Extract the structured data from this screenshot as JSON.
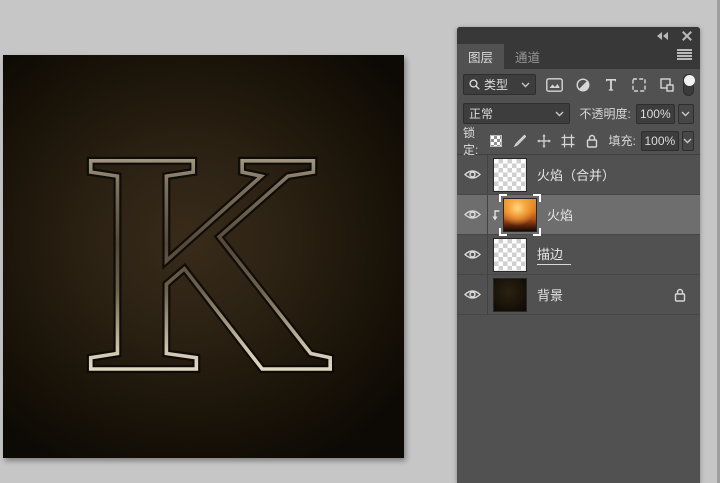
{
  "colors": {
    "page_bg": "#c6c6c6",
    "panel_bg": "#515151",
    "panel_header_bg": "#383838",
    "control_bg": "#3d3d3d",
    "selected_row_bg": "#6e6e6e",
    "text": "#dcdcdc",
    "dim_text": "#979797",
    "canvas_bg_center": "#382b1a",
    "canvas_bg_edge": "#0d0a05",
    "flame_orange": "#dd7a1d"
  },
  "canvas": {
    "letter": "K",
    "style": "metallic-outline-on-dark"
  },
  "panel": {
    "tabs": [
      {
        "label": "图层"
      },
      {
        "label": "通道"
      }
    ],
    "filter": {
      "kind_label": "类型",
      "icons": [
        "pixel-layers",
        "adjustment-layers",
        "type-layers",
        "shape-layers",
        "smart-objects"
      ],
      "toggle_state": "on"
    },
    "blend": {
      "mode": "正常",
      "opacity_label": "不透明度:",
      "opacity_value": "100%"
    },
    "lock": {
      "label": "锁定:",
      "icons": [
        "lock-transparency",
        "lock-pixels",
        "lock-position",
        "lock-artboard",
        "lock-all"
      ],
      "fill_label": "填充:",
      "fill_value": "100%"
    },
    "layers": [
      {
        "name": "火焰（合并）",
        "thumb": "checkerboard",
        "visible": true,
        "selected": false
      },
      {
        "name": "火焰",
        "thumb": "flame",
        "visible": true,
        "selected": true,
        "clipping_mask": true
      },
      {
        "name": "描边",
        "thumb": "checkerboard",
        "visible": true,
        "selected": false,
        "name_underlined": true
      },
      {
        "name": "背景",
        "thumb": "background",
        "visible": true,
        "selected": false,
        "locked": true
      }
    ]
  }
}
